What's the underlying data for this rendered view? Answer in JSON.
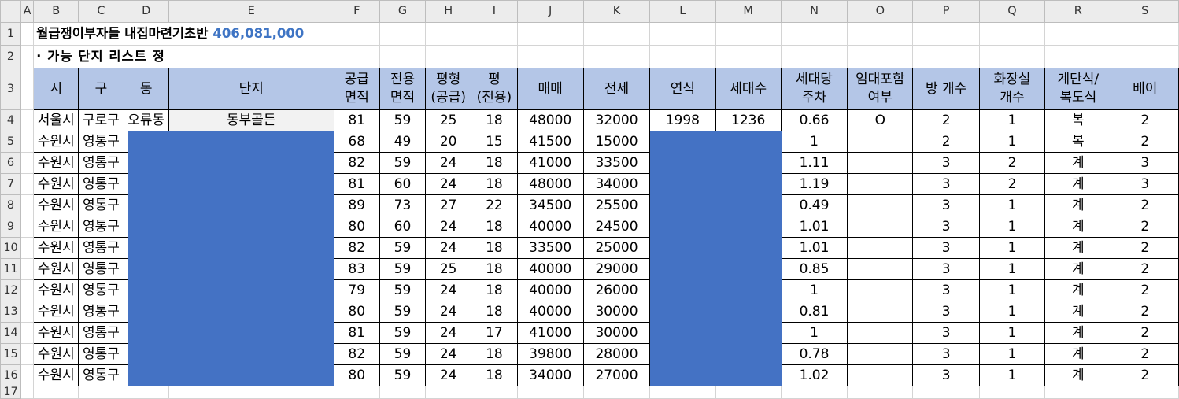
{
  "columns": [
    "",
    "A",
    "B",
    "C",
    "D",
    "E",
    "F",
    "G",
    "H",
    "I",
    "J",
    "K",
    "L",
    "M",
    "N",
    "O",
    "P",
    "Q",
    "R",
    "S"
  ],
  "row_numbers": [
    "1",
    "2",
    "3",
    "4",
    "5",
    "6",
    "7",
    "8",
    "9",
    "10",
    "11",
    "12",
    "13",
    "14",
    "15",
    "16",
    "17"
  ],
  "title": {
    "text": "월급쟁이부자들 내집마련기초반",
    "value": "406,081,000"
  },
  "subtitle": "· 가능 단지 리스트 정",
  "headers": {
    "si": "시",
    "gu": "구",
    "dong": "동",
    "danji": "단지",
    "supply_area": "공급\n면적",
    "exclusive_area": "전용\n면적",
    "pyeong_supply": "평형\n(공급)",
    "pyeong_exclusive": "평\n(전용)",
    "sale": "매매",
    "jeonse": "전세",
    "year": "연식",
    "households": "세대수",
    "parking": "세대당\n주차",
    "rental": "임대포함\n여부",
    "rooms": "방 개수",
    "bathrooms": "화장실\n개수",
    "stair_type": "계단식/\n복도식",
    "bay": "베이"
  },
  "rows": [
    {
      "si": "서울시",
      "gu": "구로구",
      "dong": "오류동",
      "danji": "동부골든",
      "supply": "81",
      "exclusive": "59",
      "py_supply": "25",
      "py_excl": "18",
      "sale": "48000",
      "jeonse": "32000",
      "year": "1998",
      "households": "1236",
      "parking": "0.66",
      "rental": "O",
      "rooms": "2",
      "baths": "1",
      "stair": "복",
      "bay": "2"
    },
    {
      "si": "수원시",
      "gu": "영통구",
      "dong": "",
      "danji": "",
      "supply": "68",
      "exclusive": "49",
      "py_supply": "20",
      "py_excl": "15",
      "sale": "41500",
      "jeonse": "15000",
      "year": "",
      "households": "",
      "parking": "1",
      "rental": "",
      "rooms": "2",
      "baths": "1",
      "stair": "복",
      "bay": "2"
    },
    {
      "si": "수원시",
      "gu": "영통구",
      "dong": "",
      "danji": "",
      "supply": "82",
      "exclusive": "59",
      "py_supply": "24",
      "py_excl": "18",
      "sale": "41000",
      "jeonse": "33500",
      "year": "",
      "households": "",
      "parking": "1.11",
      "rental": "",
      "rooms": "3",
      "baths": "2",
      "stair": "계",
      "bay": "3"
    },
    {
      "si": "수원시",
      "gu": "영통구",
      "dong": "",
      "danji": "",
      "supply": "81",
      "exclusive": "60",
      "py_supply": "24",
      "py_excl": "18",
      "sale": "48000",
      "jeonse": "34000",
      "year": "",
      "households": "",
      "parking": "1.19",
      "rental": "",
      "rooms": "3",
      "baths": "2",
      "stair": "계",
      "bay": "3"
    },
    {
      "si": "수원시",
      "gu": "영통구",
      "dong": "",
      "danji": "",
      "supply": "89",
      "exclusive": "73",
      "py_supply": "27",
      "py_excl": "22",
      "sale": "34500",
      "jeonse": "25500",
      "year": "",
      "households": "",
      "parking": "0.49",
      "rental": "",
      "rooms": "3",
      "baths": "1",
      "stair": "계",
      "bay": "2"
    },
    {
      "si": "수원시",
      "gu": "영통구",
      "dong": "",
      "danji": "",
      "supply": "80",
      "exclusive": "60",
      "py_supply": "24",
      "py_excl": "18",
      "sale": "40000",
      "jeonse": "24500",
      "year": "",
      "households": "",
      "parking": "1.01",
      "rental": "",
      "rooms": "3",
      "baths": "1",
      "stair": "계",
      "bay": "2"
    },
    {
      "si": "수원시",
      "gu": "영통구",
      "dong": "",
      "danji": "",
      "supply": "82",
      "exclusive": "59",
      "py_supply": "24",
      "py_excl": "18",
      "sale": "33500",
      "jeonse": "25000",
      "year": "",
      "households": "",
      "parking": "1.01",
      "rental": "",
      "rooms": "3",
      "baths": "1",
      "stair": "계",
      "bay": "2"
    },
    {
      "si": "수원시",
      "gu": "영통구",
      "dong": "",
      "danji": "",
      "supply": "83",
      "exclusive": "59",
      "py_supply": "25",
      "py_excl": "18",
      "sale": "40000",
      "jeonse": "29000",
      "year": "",
      "households": "",
      "parking": "0.85",
      "rental": "",
      "rooms": "3",
      "baths": "1",
      "stair": "계",
      "bay": "2"
    },
    {
      "si": "수원시",
      "gu": "영통구",
      "dong": "",
      "danji": "",
      "supply": "79",
      "exclusive": "59",
      "py_supply": "24",
      "py_excl": "18",
      "sale": "40000",
      "jeonse": "26000",
      "year": "",
      "households": "",
      "parking": "1",
      "rental": "",
      "rooms": "3",
      "baths": "1",
      "stair": "계",
      "bay": "2"
    },
    {
      "si": "수원시",
      "gu": "영통구",
      "dong": "",
      "danji": "",
      "supply": "80",
      "exclusive": "59",
      "py_supply": "24",
      "py_excl": "18",
      "sale": "40000",
      "jeonse": "30000",
      "year": "",
      "households": "",
      "parking": "0.81",
      "rental": "",
      "rooms": "3",
      "baths": "1",
      "stair": "계",
      "bay": "2"
    },
    {
      "si": "수원시",
      "gu": "영통구",
      "dong": "",
      "danji": "",
      "supply": "81",
      "exclusive": "59",
      "py_supply": "24",
      "py_excl": "17",
      "sale": "41000",
      "jeonse": "30000",
      "year": "",
      "households": "",
      "parking": "1",
      "rental": "",
      "rooms": "3",
      "baths": "1",
      "stair": "계",
      "bay": "2"
    },
    {
      "si": "수원시",
      "gu": "영통구",
      "dong": "",
      "danji": "",
      "supply": "82",
      "exclusive": "59",
      "py_supply": "24",
      "py_excl": "18",
      "sale": "39800",
      "jeonse": "28000",
      "year": "",
      "households": "",
      "parking": "0.78",
      "rental": "",
      "rooms": "3",
      "baths": "1",
      "stair": "계",
      "bay": "2"
    },
    {
      "si": "수원시",
      "gu": "영통구",
      "dong": "",
      "danji": "",
      "supply": "80",
      "exclusive": "59",
      "py_supply": "24",
      "py_excl": "18",
      "sale": "34000",
      "jeonse": "27000",
      "year": "",
      "households": "",
      "parking": "1.02",
      "rental": "",
      "rooms": "3",
      "baths": "1",
      "stair": "계",
      "bay": "2"
    }
  ],
  "colors": {
    "header_fill": "#b4c6e7",
    "redaction": "#4472c4",
    "title_value": "#3e74c4"
  }
}
